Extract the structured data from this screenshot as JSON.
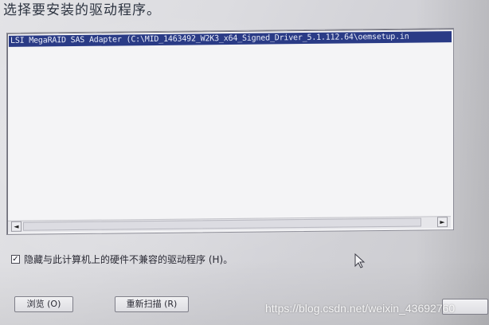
{
  "dialog": {
    "title": "选择要安装的驱动程序。"
  },
  "driver_list": {
    "items": [
      {
        "label": "LSI MegaRAID SAS Adapter (C:\\MID_1463492_W2K3_x64_Signed_Driver_5.1.112.64\\oemsetup.in",
        "selected": true
      }
    ],
    "scroll_left_glyph": "◄",
    "scroll_right_glyph": "►"
  },
  "options": {
    "hide_incompatible_label": "隐藏与此计算机上的硬件不兼容的驱动程序 (H)。",
    "hide_incompatible_checked": true,
    "check_glyph": "✓"
  },
  "buttons": {
    "browse_label": "浏览 (O)",
    "rescan_label": "重新扫描 (R)",
    "next_label": ""
  },
  "watermark": {
    "text": "https://blog.csdn.net/weixin_43692760"
  },
  "colors": {
    "selection": "#2a3b86",
    "background": "#dcdce0"
  }
}
